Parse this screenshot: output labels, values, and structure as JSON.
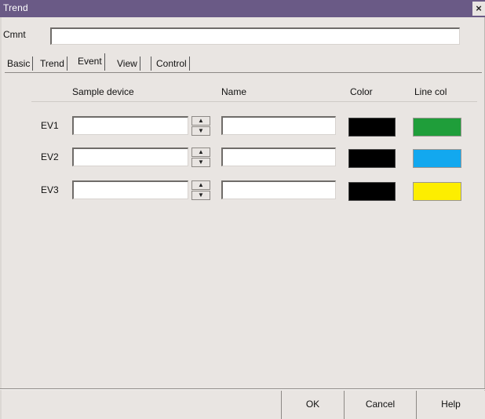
{
  "window": {
    "title": "Trend",
    "close_symbol": "×"
  },
  "comment": {
    "label": "Cmnt",
    "value": "",
    "placeholder": ""
  },
  "tabs": [
    {
      "label": "Basic",
      "active": false
    },
    {
      "label": "Trend",
      "active": false
    },
    {
      "label": "Event",
      "active": true
    },
    {
      "label": "View",
      "active": false
    },
    {
      "label": "Control",
      "active": false
    }
  ],
  "event_tab": {
    "headers": {
      "sample_device": "Sample device",
      "name": "Name",
      "color": "Color",
      "line_color": "Line col"
    },
    "rows": [
      {
        "label": "EV1",
        "sample_device": "",
        "name": "",
        "color": "#000000",
        "line_color": "#1f9e3a"
      },
      {
        "label": "EV2",
        "sample_device": "",
        "name": "",
        "color": "#000000",
        "line_color": "#12a8ef"
      },
      {
        "label": "EV3",
        "sample_device": "",
        "name": "",
        "color": "#000000",
        "line_color": "#fdee00"
      }
    ]
  },
  "footer": {
    "ok_label": "OK",
    "cancel_label": "Cancel",
    "help_label": "Help"
  },
  "colors": {
    "titlebar": "#6a5a86",
    "dialog_bg": "#e9e5e2"
  }
}
